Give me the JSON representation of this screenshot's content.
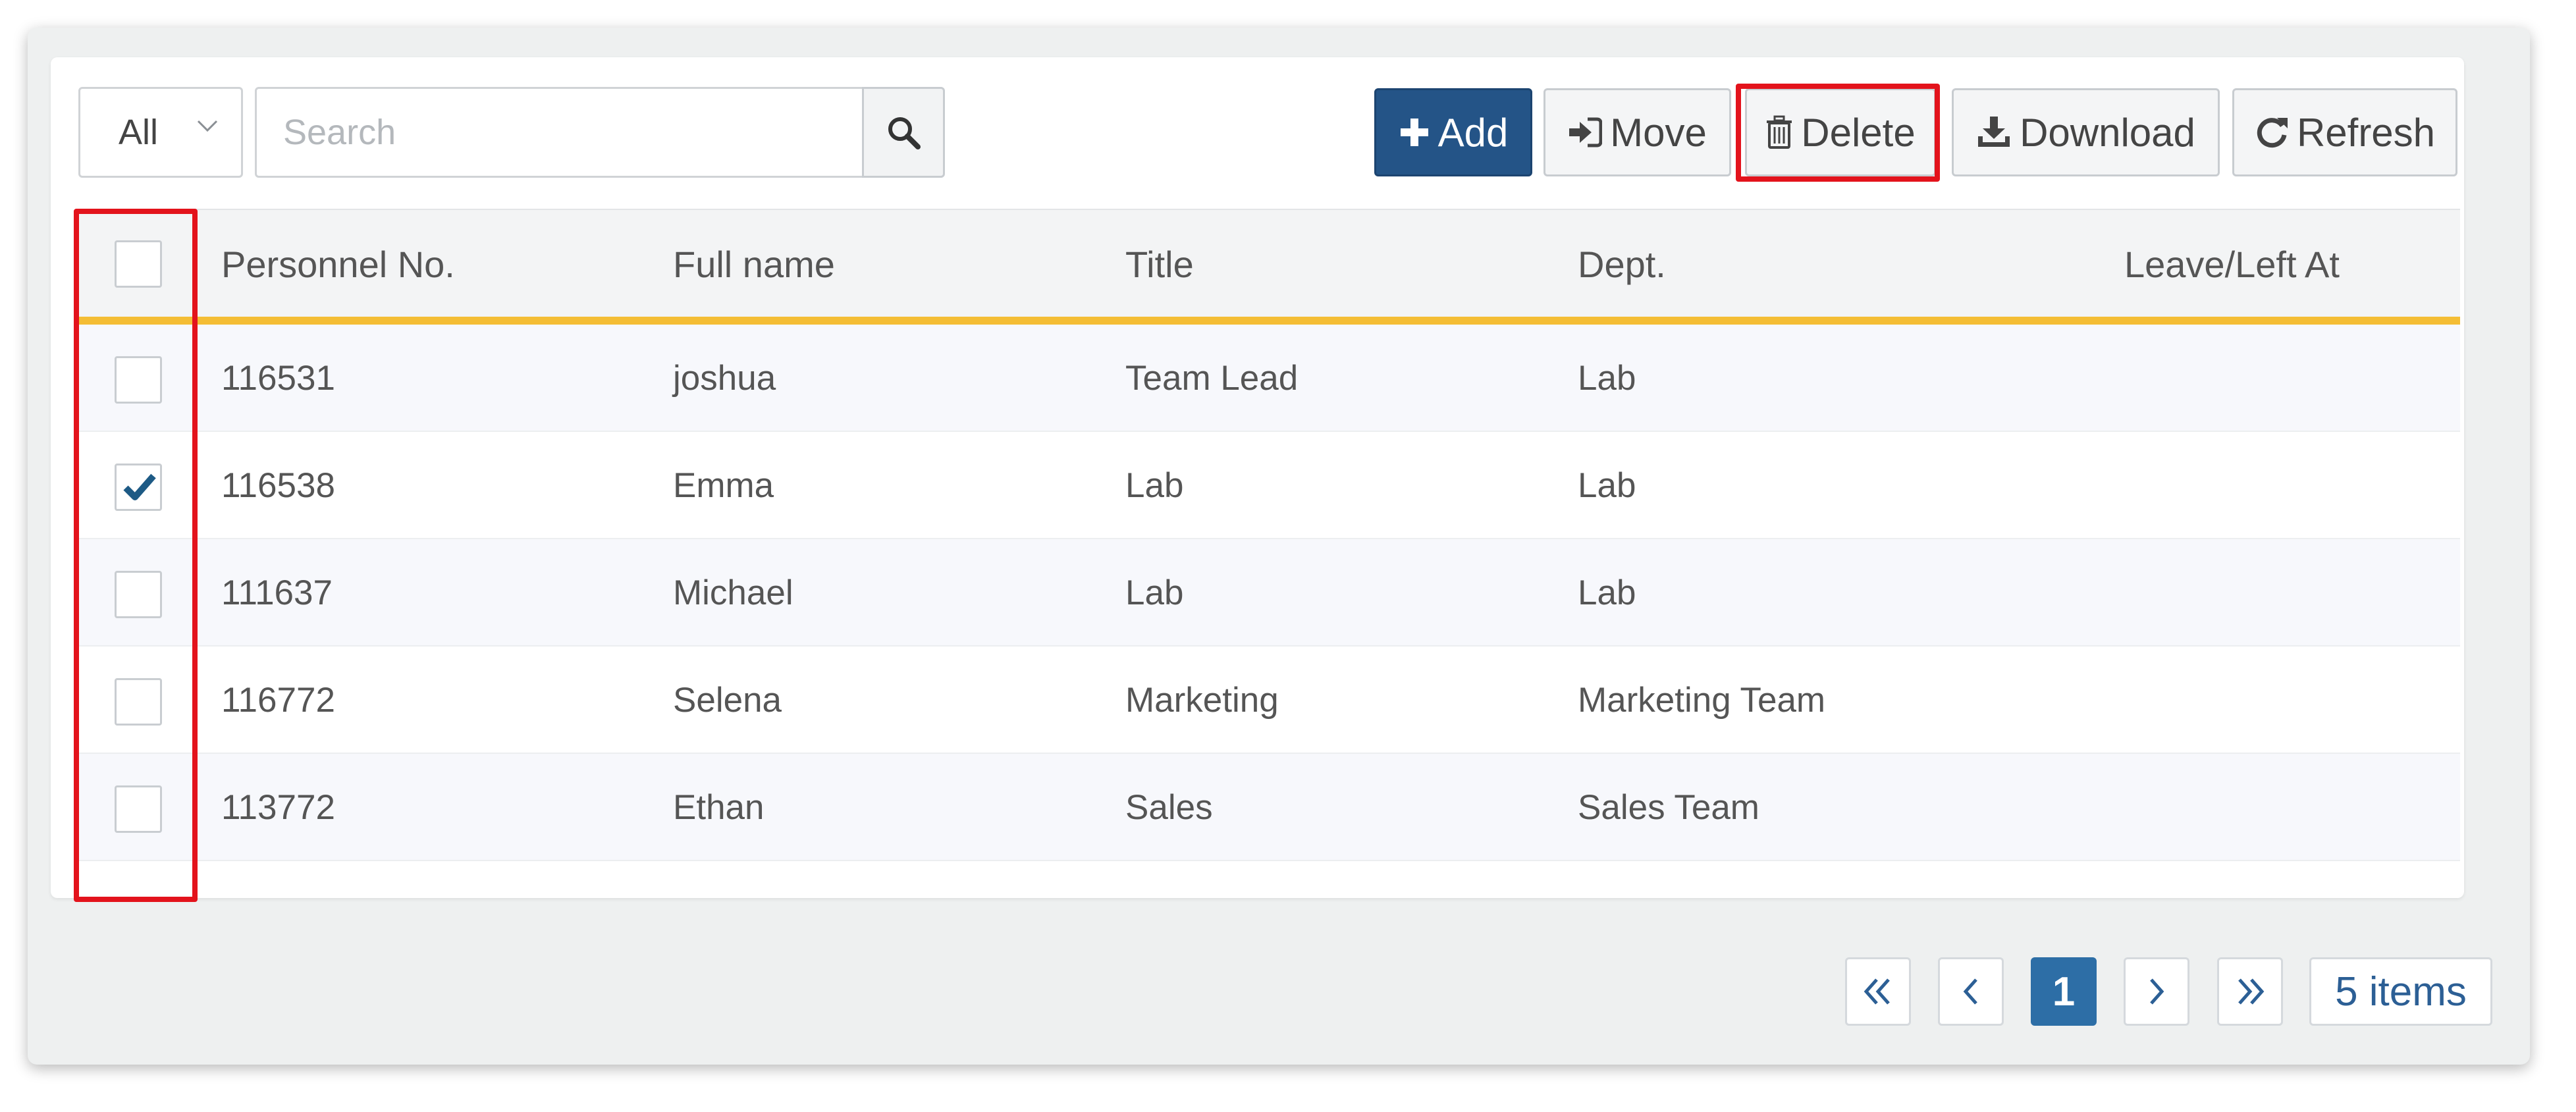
{
  "toolbar": {
    "filter_value": "All",
    "search_placeholder": "Search",
    "add_label": "Add",
    "move_label": "Move",
    "delete_label": "Delete",
    "download_label": "Download",
    "refresh_label": "Refresh"
  },
  "table": {
    "columns": [
      "Personnel No.",
      "Full name",
      "Title",
      "Dept.",
      "Leave/Left At"
    ],
    "rows": [
      {
        "checked": false,
        "cells": [
          "116531",
          "joshua",
          "Team Lead",
          "Lab",
          ""
        ]
      },
      {
        "checked": true,
        "cells": [
          "116538",
          "Emma",
          "Lab",
          "Lab",
          ""
        ]
      },
      {
        "checked": false,
        "cells": [
          "111637",
          "Michael",
          "Lab",
          "Lab",
          ""
        ]
      },
      {
        "checked": false,
        "cells": [
          "116772",
          "Selena",
          "Marketing",
          "Marketing Team",
          ""
        ]
      },
      {
        "checked": false,
        "cells": [
          "113772",
          "Ethan",
          "Sales",
          "Sales Team",
          ""
        ]
      }
    ]
  },
  "pagination": {
    "current_page": "1",
    "items_label": "5 items"
  },
  "colors": {
    "primary": "#245487",
    "header_accent": "#f4bd35",
    "highlight": "#e3131c",
    "link": "#2c5f95"
  },
  "icons": {
    "filter_caret": "chevron-down-icon",
    "search": "search-icon",
    "add": "plus-icon",
    "move": "sign-in-arrow-icon",
    "delete": "trash-icon",
    "download": "download-icon",
    "refresh": "refresh-icon",
    "checkbox_checked": "check-icon",
    "first_page": "double-chevron-left-icon",
    "prev_page": "chevron-left-icon",
    "next_page": "chevron-right-icon",
    "last_page": "double-chevron-right-icon"
  }
}
